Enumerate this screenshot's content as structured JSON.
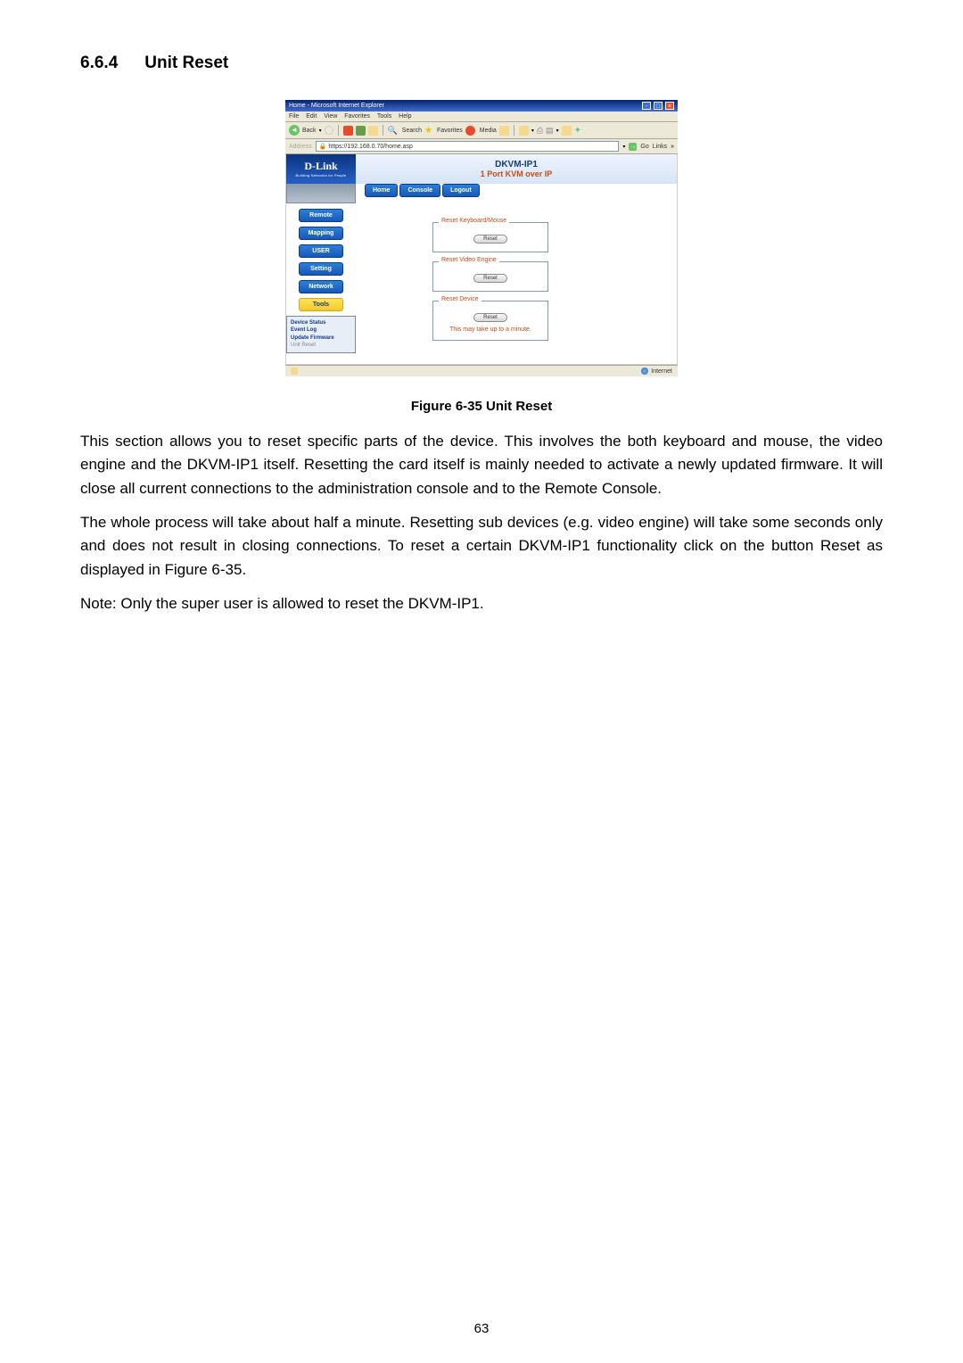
{
  "section": {
    "number": "6.6.4",
    "title": "Unit Reset"
  },
  "ie": {
    "title": "Home - Microsoft Internet Explorer",
    "menu": {
      "file": "File",
      "edit": "Edit",
      "view": "View",
      "favorites": "Favorites",
      "tools": "Tools",
      "help": "Help"
    },
    "toolbar": {
      "back": "Back",
      "search": "Search",
      "favorites": "Favorites",
      "media": "Media"
    },
    "address_label": "Address",
    "address_value": "https://192.168.0.70/home.asp",
    "go": "Go",
    "links": "Links",
    "status_zone": "Internet"
  },
  "dlink": {
    "brand": "D-Link",
    "tagline": "Building Networks for People",
    "product": "DKVM-IP1",
    "product_desc": "1 Port KVM over IP",
    "tabs": {
      "home": "Home",
      "console": "Console",
      "logout": "Logout"
    },
    "sidebar": {
      "remote": "Remote",
      "mapping": "Mapping",
      "user": "USER",
      "setting": "Setting",
      "network": "Network",
      "tools": "Tools",
      "sub": {
        "device_status": "Device Status",
        "event_log": "Event Log",
        "update_firmware": "Update Firmware",
        "unit_reset": "Unit Reset"
      }
    },
    "reset_panels": {
      "kb_mouse": {
        "legend": "Reset Keyboard/Mouse",
        "btn": "Reset"
      },
      "video": {
        "legend": "Reset Video Engine",
        "btn": "Reset"
      },
      "device": {
        "legend": "Reset Device",
        "btn": "Reset",
        "note": "This may take up to a minute."
      }
    }
  },
  "figure_caption": "Figure 6-35 Unit Reset",
  "para1": "This section allows you to reset specific parts of the device. This involves the both keyboard and mouse, the video engine and the DKVM-IP1 itself. Resetting the card itself is mainly needed to activate a newly updated firmware. It will close all current connections to the administration console and to the Remote Console.",
  "para2": "The whole process will take about half a minute. Resetting sub devices (e.g. video engine) will take some seconds only and does not result in closing connections. To reset a certain DKVM-IP1 functionality click on the button Reset as displayed in Figure 6-35.",
  "para3": "Note: Only the super user is allowed to reset the DKVM-IP1.",
  "page_number": "63"
}
